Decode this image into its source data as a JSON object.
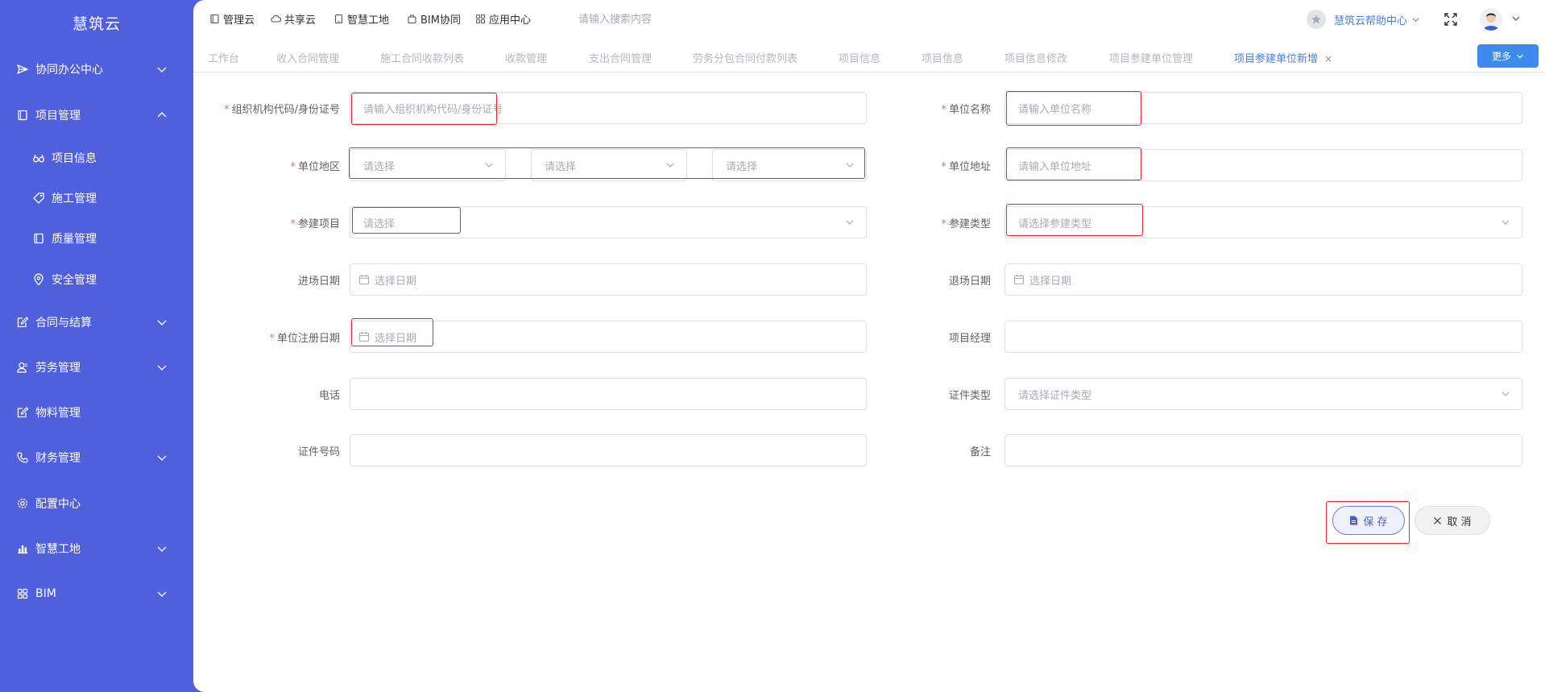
{
  "brand": "慧筑云",
  "sidebar": {
    "items": [
      {
        "label": "协同办公中心",
        "icon": "send-icon"
      },
      {
        "label": "项目管理",
        "icon": "book-icon"
      },
      {
        "label": "项目信息",
        "icon": "glasses-icon"
      },
      {
        "label": "施工管理",
        "icon": "tag-icon"
      },
      {
        "label": "质量管理",
        "icon": "book-icon"
      },
      {
        "label": "安全管理",
        "icon": "location-icon"
      },
      {
        "label": "合同与结算",
        "icon": "edit-icon"
      },
      {
        "label": "劳务管理",
        "icon": "user-icon"
      },
      {
        "label": "物料管理",
        "icon": "edit-icon"
      },
      {
        "label": "财务管理",
        "icon": "phone-icon"
      },
      {
        "label": "配置中心",
        "icon": "gear-icon"
      },
      {
        "label": "智慧工地",
        "icon": "bar-chart-icon"
      },
      {
        "label": "BIM",
        "icon": "grid-icon"
      }
    ]
  },
  "topnav": {
    "items": [
      "管理云",
      "共享云",
      "智慧工地",
      "BIM协同",
      "应用中心"
    ],
    "search_placeholder": "请输入搜索内容",
    "help": "慧筑云帮助中心"
  },
  "tabs": {
    "items": [
      "工作台",
      "收入合同管理",
      "施工合同收款列表",
      "收款管理",
      "支出合同管理",
      "劳务分包合同付款列表",
      "项目信息",
      "项目信息",
      "项目信息修改",
      "项目参建单位管理",
      "项目参建单位新增"
    ],
    "close": "×",
    "more": "更多"
  },
  "form": {
    "org_code": {
      "label": "组织机构代码/身份证号",
      "placeholder": "请输入组织机构代码/身份证号"
    },
    "unit_name": {
      "label": "单位名称",
      "placeholder": "请输入单位名称"
    },
    "region": {
      "label": "单位地区",
      "placeholder_1": "请选择",
      "placeholder_2": "请选择",
      "placeholder_3": "请选择"
    },
    "address": {
      "label": "单位地址",
      "placeholder": "请输入单位地址"
    },
    "project": {
      "label": "参建项目",
      "placeholder": "请选择"
    },
    "type": {
      "label": "参建类型",
      "placeholder": "请选择参建类型"
    },
    "entry_date": {
      "label": "进场日期",
      "placeholder": "选择日期"
    },
    "exit_date": {
      "label": "退场日期",
      "placeholder": "选择日期"
    },
    "reg_date": {
      "label": "单位注册日期",
      "placeholder": "选择日期"
    },
    "manager": {
      "label": "项目经理",
      "value": ""
    },
    "phone": {
      "label": "电话",
      "value": ""
    },
    "cert_type": {
      "label": "证件类型",
      "placeholder": "请选择证件类型"
    },
    "cert_no": {
      "label": "证件号码",
      "value": ""
    },
    "remark": {
      "label": "备注",
      "value": ""
    },
    "required_mark": "*"
  },
  "buttons": {
    "save": "保 存",
    "cancel": "取 消"
  },
  "colors": {
    "sidebar": "#5060dc",
    "accent": "#4a7fe6",
    "required": "#f56c6c",
    "highlight": "#f5222d"
  }
}
